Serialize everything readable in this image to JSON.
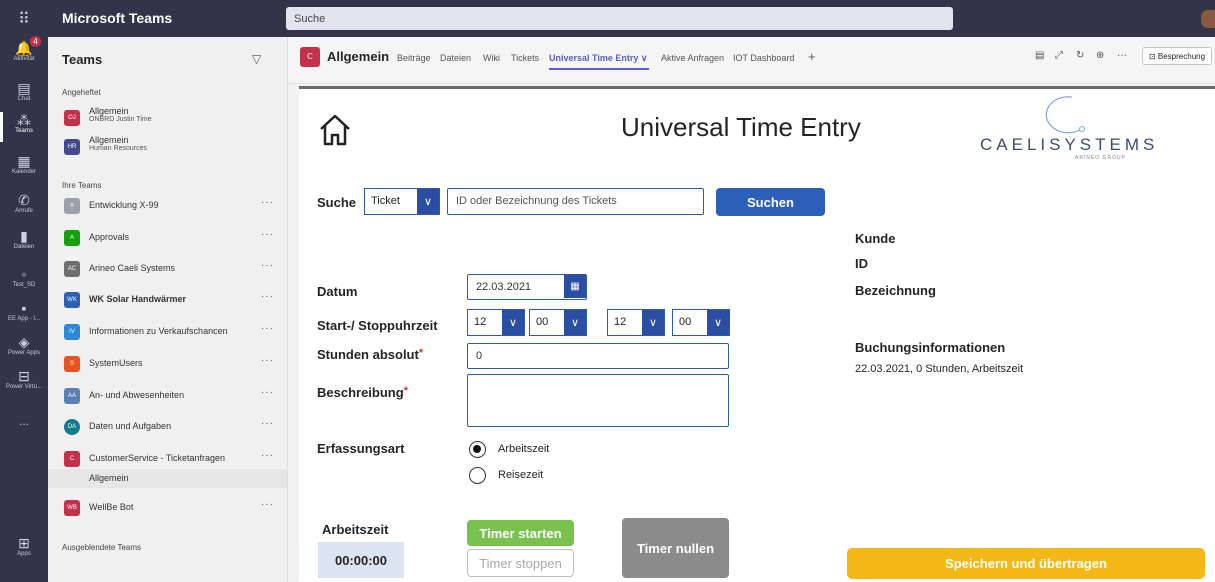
{
  "app": {
    "title": "Microsoft Teams",
    "search_placeholder": "Suche"
  },
  "rail": [
    {
      "label": "Aktivität",
      "icon": "bell-icon",
      "badge": "4"
    },
    {
      "label": "Chat",
      "icon": "chat-icon"
    },
    {
      "label": "Teams",
      "icon": "teams-icon",
      "active": true
    },
    {
      "label": "Kalender",
      "icon": "calendar-icon"
    },
    {
      "label": "Anrufe",
      "icon": "phone-icon"
    },
    {
      "label": "Dateien",
      "icon": "files-icon"
    },
    {
      "label": "Test_SD",
      "icon": "app-icon"
    },
    {
      "label": "EE App - I...",
      "icon": "app-icon"
    },
    {
      "label": "Power Apps",
      "icon": "power-apps-icon"
    },
    {
      "label": "Power Virtu...",
      "icon": "power-virtual-agents-icon"
    },
    {
      "label": "...",
      "icon": "more-icon"
    },
    {
      "label": "Apps",
      "icon": "apps-icon"
    }
  ],
  "teams_pane": {
    "title": "Teams",
    "pinned_label": "Angeheftet",
    "pinned": [
      {
        "name": "Allgemein",
        "sub": "ONBRD Justin Time",
        "abbr": "OJ",
        "color": "#c4314b"
      },
      {
        "name": "Allgemein",
        "sub": "Human Resources",
        "abbr": "HR",
        "color": "#444791"
      }
    ],
    "your_teams_label": "Ihre Teams",
    "teams": [
      {
        "name": "Entwicklung X-99",
        "abbr": "X",
        "color": "#9aa0a6",
        "bold": false
      },
      {
        "name": "Approvals",
        "abbr": "A",
        "color": "#13a10e",
        "bold": false
      },
      {
        "name": "Arineo Caeli Systems",
        "abbr": "AC",
        "color": "#6e6e6e",
        "bold": false
      },
      {
        "name": "WK Solar Handwärmer",
        "abbr": "WK",
        "color": "#2b5fb8",
        "bold": true
      },
      {
        "name": "Informationen zu Verkaufschancen",
        "abbr": "IV",
        "color": "#2b88d8",
        "bold": false
      },
      {
        "name": "SystemUsers",
        "abbr": "S",
        "color": "#e8541e",
        "bold": false
      },
      {
        "name": "An- und Abwesenheiten",
        "abbr": "AA",
        "color": "#5a7fb5",
        "bold": false
      },
      {
        "name": "Daten und Aufgaben",
        "abbr": "DA",
        "color": "#0f7b8c",
        "bold": false
      },
      {
        "name": "CustomerService - Ticketanfragen",
        "abbr": "C",
        "color": "#c4314b",
        "bold": false
      }
    ],
    "active_channel": "Allgemein",
    "bot": {
      "name": "WellBe Bot",
      "abbr": "WB",
      "color": "#c4314b"
    },
    "hidden_label": "Ausgeblendete Teams"
  },
  "channel": {
    "abbr": "C",
    "name": "Allgemein",
    "tabs": [
      "Beiträge",
      "Dateien",
      "Wiki",
      "Tickets",
      "Universal Time Entry ∨",
      "Aktive Anfragen",
      "IOT Dashboard",
      "+"
    ],
    "meet_label": "Besprechung"
  },
  "ute": {
    "title": "Universal Time Entry",
    "logo_text": "CAELISYSTEMS",
    "logo_sub": "ARINEO GROUP",
    "search_label": "Suche",
    "search_type": "Ticket",
    "search_placeholder": "ID oder Bezeichnung des Tickets",
    "search_button": "Suchen",
    "date_label": "Datum",
    "date_value": "22.03.2021",
    "time_label": "Start-/ Stoppuhrzeit",
    "start_hour": "12",
    "start_min": "00",
    "stop_hour": "12",
    "stop_min": "00",
    "hours_label": "Stunden absolut",
    "hours_value": "0",
    "desc_label": "Beschreibung",
    "required_mark": "*",
    "type_label": "Erfassungsart",
    "type_options": [
      "Arbeitszeit",
      "Reisezeit"
    ],
    "type_selected": "Arbeitszeit",
    "customer_label": "Kunde",
    "id_label": "ID",
    "designation_label": "Bezeichnung",
    "booking_title": "Buchungsinformationen",
    "booking_value": "22.03.2021, 0 Stunden, Arbeitszeit",
    "timer_title": "Arbeitszeit",
    "timer_value": "00:00:00",
    "timer_start": "Timer starten",
    "timer_stop": "Timer stoppen",
    "timer_reset": "Timer nullen",
    "save_button": "Speichern und übertragen"
  }
}
